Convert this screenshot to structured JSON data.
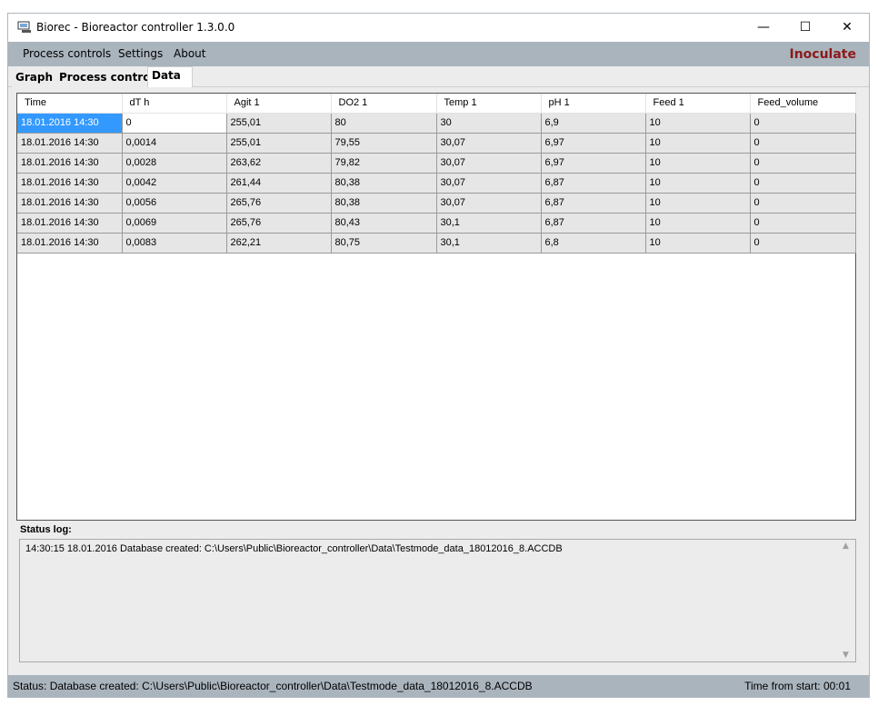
{
  "window": {
    "title": "Biorec - Bioreactor controller 1.3.0.0",
    "minimize": "—",
    "maximize": "☐",
    "close": "✕"
  },
  "menu": {
    "process_controls": "Process controls",
    "settings": "Settings",
    "about": "About",
    "inoculate": "Inoculate"
  },
  "tabs": {
    "graph": "Graph",
    "process_control": "Process control",
    "data": "Data"
  },
  "grid": {
    "columns": [
      "Time",
      "dT h",
      "Agit 1",
      "DO2 1",
      "Temp 1",
      "pH 1",
      "Feed 1",
      "Feed_volume"
    ],
    "rows": [
      [
        "18.01.2016 14:30",
        "0",
        "255,01",
        "80",
        "30",
        "6,9",
        "10",
        "0"
      ],
      [
        "18.01.2016 14:30",
        "0,0014",
        "255,01",
        "79,55",
        "30,07",
        "6,97",
        "10",
        "0"
      ],
      [
        "18.01.2016 14:30",
        "0,0028",
        "263,62",
        "79,82",
        "30,07",
        "6,97",
        "10",
        "0"
      ],
      [
        "18.01.2016 14:30",
        "0,0042",
        "261,44",
        "80,38",
        "30,07",
        "6,87",
        "10",
        "0"
      ],
      [
        "18.01.2016 14:30",
        "0,0056",
        "265,76",
        "80,38",
        "30,07",
        "6,87",
        "10",
        "0"
      ],
      [
        "18.01.2016 14:30",
        "0,0069",
        "265,76",
        "80,43",
        "30,1",
        "6,87",
        "10",
        "0"
      ],
      [
        "18.01.2016 14:30",
        "0,0083",
        "262,21",
        "80,75",
        "30,1",
        "6,8",
        "10",
        "0"
      ]
    ]
  },
  "status_log": {
    "label": "Status log:",
    "entries": [
      "14:30:15 18.01.2016 Database created: C:\\Users\\Public\\Bioreactor_controller\\Data\\Testmode_data_18012016_8.ACCDB"
    ]
  },
  "statusbar": {
    "status": "Status: Database created: C:\\Users\\Public\\Bioreactor_controller\\Data\\Testmode_data_18012016_8.ACCDB",
    "time_from_start": "Time from start: 00:01"
  },
  "colors": {
    "menubar": "#aab4bd",
    "inoculate": "#8b1a1a",
    "selection": "#3399ff"
  }
}
